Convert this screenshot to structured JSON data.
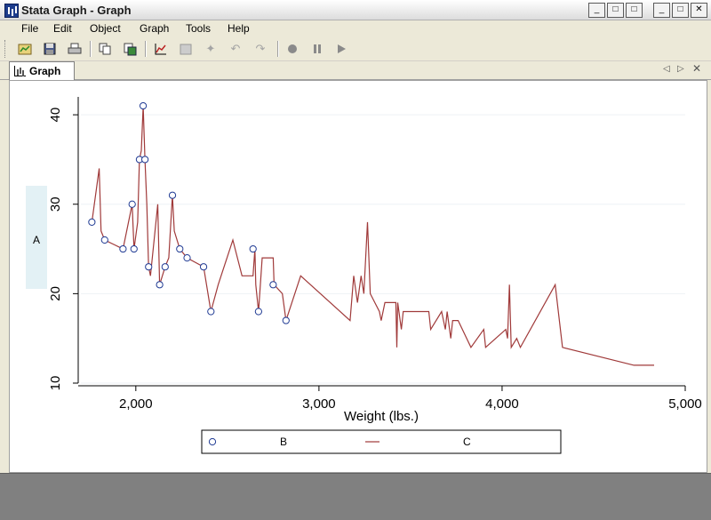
{
  "window": {
    "title": "Stata Graph - Graph",
    "buttons": [
      "_",
      "□",
      "□",
      "_",
      "□",
      "✕"
    ]
  },
  "menu": [
    "File",
    "Edit",
    "Object",
    "Graph",
    "Tools",
    "Help"
  ],
  "toolbar": {
    "icons": [
      "open-graph-icon",
      "save-icon",
      "print-icon",
      "copy-icon",
      "export-icon",
      "graph-editor-icon",
      "recorder-icon",
      "pointer-icon",
      "rotate-icon",
      "undo-icon",
      "record-icon",
      "pause-icon",
      "play-icon"
    ]
  },
  "tab": {
    "label": "Graph"
  },
  "chart_data": {
    "type": "scatter",
    "xlabel": "Weight (lbs.)",
    "ylabel": "A",
    "xlim": [
      1700,
      5000
    ],
    "ylim": [
      10,
      42
    ],
    "xticks": [
      2000,
      3000,
      4000,
      5000
    ],
    "xtick_labels": [
      "2,000",
      "3,000",
      "4,000",
      "5,000"
    ],
    "yticks": [
      10,
      20,
      30,
      40
    ],
    "ytick_labels": [
      "10",
      "20",
      "30",
      "40"
    ],
    "grid": "horizontal",
    "legend": {
      "placement": "bottom",
      "entries": [
        "B",
        "C"
      ]
    },
    "series": [
      {
        "name": "B",
        "type": "scatter",
        "marker": "hollow-circle",
        "color": "#1f3a93",
        "points": [
          [
            1760,
            28
          ],
          [
            1830,
            26
          ],
          [
            1930,
            25
          ],
          [
            1980,
            30
          ],
          [
            1990,
            25
          ],
          [
            2020,
            35
          ],
          [
            2040,
            41
          ],
          [
            2050,
            35
          ],
          [
            2070,
            23
          ],
          [
            2130,
            21
          ],
          [
            2160,
            23
          ],
          [
            2200,
            31
          ],
          [
            2240,
            25
          ],
          [
            2280,
            24
          ],
          [
            2370,
            23
          ],
          [
            2410,
            18
          ],
          [
            2640,
            25
          ],
          [
            2670,
            18
          ],
          [
            2750,
            21
          ],
          [
            2820,
            17
          ]
        ]
      },
      {
        "name": "C",
        "type": "line",
        "color": "#a03a3a",
        "points": [
          [
            1760,
            28
          ],
          [
            1800,
            34
          ],
          [
            1810,
            27
          ],
          [
            1830,
            26
          ],
          [
            1930,
            25
          ],
          [
            1980,
            30
          ],
          [
            1990,
            25
          ],
          [
            2010,
            28
          ],
          [
            2020,
            35
          ],
          [
            2030,
            36
          ],
          [
            2040,
            41
          ],
          [
            2050,
            35
          ],
          [
            2060,
            30
          ],
          [
            2070,
            23
          ],
          [
            2080,
            22
          ],
          [
            2100,
            26
          ],
          [
            2120,
            30
          ],
          [
            2130,
            21
          ],
          [
            2160,
            23
          ],
          [
            2180,
            24
          ],
          [
            2200,
            31
          ],
          [
            2210,
            27
          ],
          [
            2240,
            25
          ],
          [
            2280,
            24
          ],
          [
            2370,
            23
          ],
          [
            2410,
            18
          ],
          [
            2450,
            21
          ],
          [
            2530,
            26
          ],
          [
            2580,
            22
          ],
          [
            2640,
            22
          ],
          [
            2650,
            25
          ],
          [
            2655,
            21
          ],
          [
            2670,
            18
          ],
          [
            2690,
            24
          ],
          [
            2750,
            24
          ],
          [
            2755,
            21
          ],
          [
            2800,
            20
          ],
          [
            2820,
            17
          ],
          [
            2900,
            22
          ],
          [
            3170,
            17
          ],
          [
            3190,
            22
          ],
          [
            3210,
            19
          ],
          [
            3230,
            22
          ],
          [
            3245,
            20
          ],
          [
            3265,
            28
          ],
          [
            3280,
            20
          ],
          [
            3330,
            18
          ],
          [
            3340,
            17
          ],
          [
            3360,
            19
          ],
          [
            3420,
            19
          ],
          [
            3425,
            14
          ],
          [
            3430,
            19
          ],
          [
            3450,
            16
          ],
          [
            3460,
            18
          ],
          [
            3600,
            18
          ],
          [
            3610,
            16
          ],
          [
            3670,
            18
          ],
          [
            3690,
            16
          ],
          [
            3700,
            18
          ],
          [
            3720,
            15
          ],
          [
            3730,
            17
          ],
          [
            3760,
            17
          ],
          [
            3830,
            14
          ],
          [
            3900,
            16
          ],
          [
            3910,
            14
          ],
          [
            4020,
            16
          ],
          [
            4030,
            15
          ],
          [
            4040,
            21
          ],
          [
            4050,
            14
          ],
          [
            4080,
            15
          ],
          [
            4100,
            14
          ],
          [
            4290,
            21
          ],
          [
            4330,
            14
          ],
          [
            4720,
            12
          ],
          [
            4830,
            12
          ]
        ]
      }
    ]
  }
}
